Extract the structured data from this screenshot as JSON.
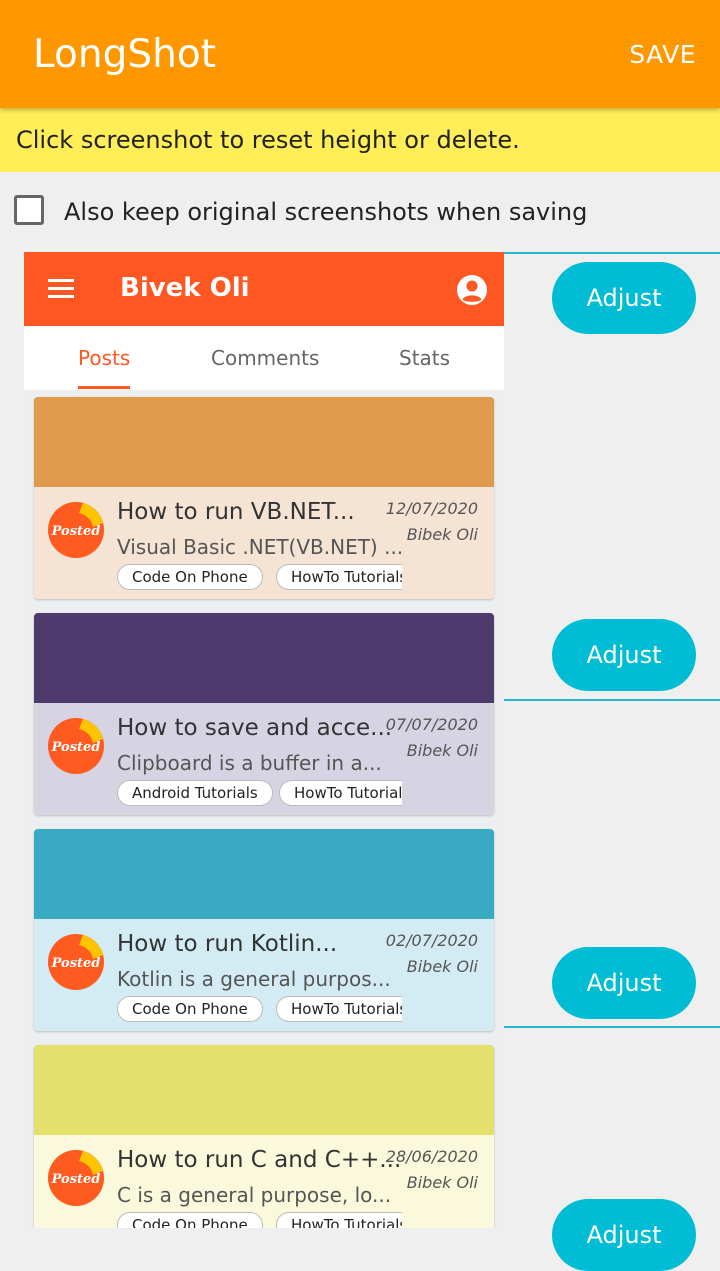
{
  "app": {
    "title": "LongShot",
    "save_label": "SAVE"
  },
  "hint": "Click screenshot to reset height or delete.",
  "keep_original": {
    "label": "Also keep original screenshots when saving",
    "checked": false
  },
  "adjust_label": "Adjust",
  "screenshot": {
    "app_bar": {
      "name": "Bivek Oli"
    },
    "tabs": [
      "Posts",
      "Comments",
      "Stats"
    ],
    "active_tab": "Posts",
    "badge_text": "Posted",
    "posts": [
      {
        "title": "How to run VB.NET...",
        "desc": "Visual Basic .NET(VB.NET) ...",
        "date": "12/07/2020",
        "author": "Bibek Oli",
        "tags": [
          "Code On Phone",
          "HowTo Tutorials"
        ],
        "cover_color": "#e09a4d",
        "body_color": "#f5e4d4"
      },
      {
        "title": "How to save and acce...",
        "desc": "Clipboard is a buffer in a...",
        "date": "07/07/2020",
        "author": "Bibek Oli",
        "tags": [
          "Android Tutorials",
          "HowTo Tutorials"
        ],
        "cover_color": "#4e3a6c",
        "body_color": "#d6d3e3"
      },
      {
        "title": "How to run Kotlin...",
        "desc": "Kotlin is a general purpos...",
        "date": "02/07/2020",
        "author": "Bibek Oli",
        "tags": [
          "Code On Phone",
          "HowTo Tutorials"
        ],
        "cover_color": "#3aaac3",
        "body_color": "#d3ecf3"
      },
      {
        "title": "How to run C and C++...",
        "desc": "C is a general purpose, lo...",
        "date": "28/06/2020",
        "author": "Bibek Oli",
        "tags": [
          "Code On Phone",
          "HowTo Tutorials"
        ],
        "cover_color": "#e3e06c",
        "body_color": "#fbf9dc"
      }
    ]
  },
  "colors": {
    "app_bar": "#ff9800",
    "hint_bar": "#ffee58",
    "inner_app_bar": "#ff5722",
    "adjust_button": "#00bcd4",
    "divider": "#26b6cf"
  }
}
